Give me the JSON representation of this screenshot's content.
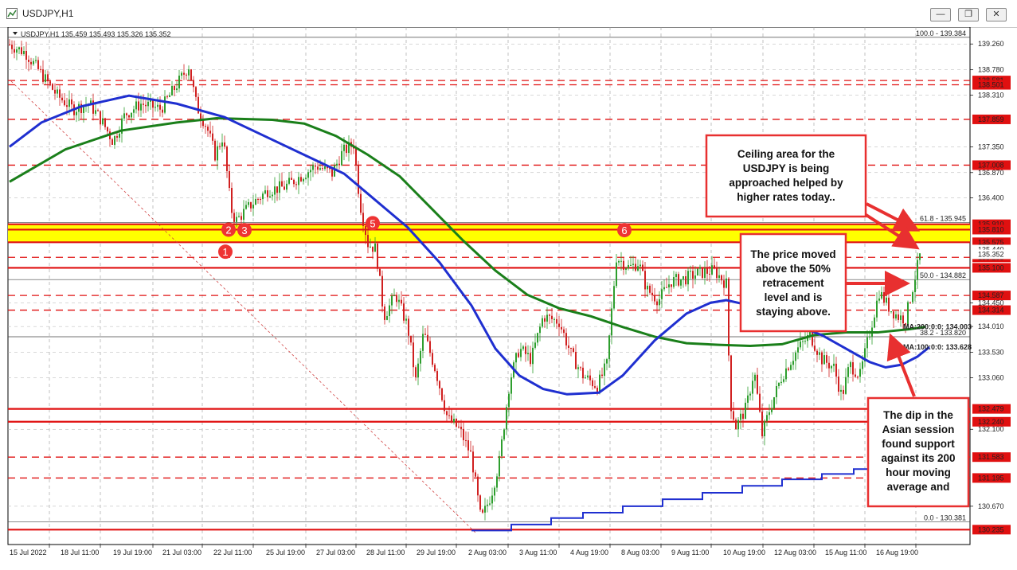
{
  "window": {
    "title": "USDJPY,H1",
    "buttons": [
      "minimize",
      "maximize",
      "close"
    ]
  },
  "chart_data": {
    "type": "candlestick",
    "symbol_label": "USDJPY,H1",
    "ohlc_header": "USDJPY,H1  135.459 135.493 135.326 135.352",
    "y_range": [
      129.9,
      139.55
    ],
    "x_labels": [
      "15 Jul 2022",
      "18 Jul 11:00",
      "19 Jul 19:00",
      "21 Jul 03:00",
      "22 Jul 11:00",
      "25 Jul 19:00",
      "27 Jul 03:00",
      "28 Jul 11:00",
      "29 Jul 19:00",
      "2 Aug 03:00",
      "3 Aug 11:00",
      "4 Aug 19:00",
      "8 Aug 03:00",
      "9 Aug 11:00",
      "10 Aug 19:00",
      "12 Aug 03:00",
      "15 Aug 11:00",
      "16 Aug 19:00"
    ],
    "y_ticks": [
      139.26,
      138.78,
      138.31,
      137.35,
      136.87,
      136.4,
      134.45,
      134.01,
      133.53,
      133.06,
      132.1,
      130.67
    ],
    "highlighted_levels": [
      {
        "value": 138.581,
        "label": "138.581",
        "style": "dashed"
      },
      {
        "value": 138.501,
        "label": "138.501",
        "style": "dashed"
      },
      {
        "value": 137.859,
        "label": "137.859",
        "style": "dashed"
      },
      {
        "value": 137.008,
        "label": "137.008",
        "style": "dashed"
      },
      {
        "value": 135.91,
        "label": "135.910",
        "style": "solid"
      },
      {
        "value": 135.81,
        "label": "135.810",
        "style": "solid"
      },
      {
        "value": 135.575,
        "label": "135.575",
        "style": "solid"
      },
      {
        "value": 135.44,
        "label": "135.440",
        "style": "none"
      },
      {
        "value": 135.295,
        "label": "135.295",
        "style": "dashed"
      },
      {
        "value": 135.1,
        "label": "135.100",
        "style": "solid"
      },
      {
        "value": 134.587,
        "label": "134.587",
        "style": "dashed"
      },
      {
        "value": 134.314,
        "label": "134.314",
        "style": "dashed"
      },
      {
        "value": 132.479,
        "label": "132.479",
        "style": "solid"
      },
      {
        "value": 132.24,
        "label": "132.240",
        "style": "solid"
      },
      {
        "value": 131.583,
        "label": "131.583",
        "style": "dashed"
      },
      {
        "value": 131.195,
        "label": "131.195",
        "style": "dashed"
      },
      {
        "value": 130.235,
        "label": "130.235",
        "style": "solid"
      }
    ],
    "current_price": {
      "value": 135.352,
      "label": "135.352"
    },
    "yellow_zone": [
      135.575,
      135.91
    ],
    "fibonacci": [
      {
        "value": 139.384,
        "label": "100.0 - 139.384"
      },
      {
        "value": 135.945,
        "label": "61.8 - 135.945"
      },
      {
        "value": 134.882,
        "label": "50.0 - 134.882"
      },
      {
        "value": 133.82,
        "label": "38.2 - 133.820"
      },
      {
        "value": 130.381,
        "label": "0.0 - 130.381"
      }
    ],
    "moving_averages": [
      {
        "name": "MA:200:0:0",
        "label": "MA:200:0:0: 134.003",
        "value": 134.003,
        "color": "#1a7f1a",
        "points": [
          [
            0,
            136.7
          ],
          [
            70,
            137.3
          ],
          [
            140,
            137.65
          ],
          [
            210,
            137.8
          ],
          [
            260,
            137.88
          ],
          [
            330,
            137.85
          ],
          [
            370,
            137.78
          ],
          [
            410,
            137.55
          ],
          [
            450,
            137.2
          ],
          [
            490,
            136.8
          ],
          [
            530,
            136.2
          ],
          [
            570,
            135.6
          ],
          [
            610,
            135.05
          ],
          [
            650,
            134.6
          ],
          [
            690,
            134.35
          ],
          [
            730,
            134.2
          ],
          [
            770,
            134.0
          ],
          [
            810,
            133.82
          ],
          [
            850,
            133.7
          ],
          [
            890,
            133.67
          ],
          [
            930,
            133.65
          ],
          [
            970,
            133.68
          ],
          [
            1010,
            133.85
          ],
          [
            1050,
            133.9
          ],
          [
            1090,
            133.9
          ],
          [
            1130,
            133.96
          ],
          [
            1150,
            134.003
          ]
        ]
      },
      {
        "name": "MA:100:0:0",
        "label": "MA:100:0:0: 133.628",
        "value": 133.628,
        "color": "#1f2fd0",
        "points": [
          [
            0,
            137.35
          ],
          [
            40,
            137.8
          ],
          [
            90,
            138.1
          ],
          [
            150,
            138.3
          ],
          [
            210,
            138.15
          ],
          [
            270,
            137.9
          ],
          [
            320,
            137.55
          ],
          [
            370,
            137.2
          ],
          [
            420,
            136.85
          ],
          [
            460,
            136.35
          ],
          [
            500,
            135.85
          ],
          [
            540,
            135.2
          ],
          [
            580,
            134.4
          ],
          [
            610,
            133.6
          ],
          [
            640,
            133.1
          ],
          [
            670,
            132.85
          ],
          [
            700,
            132.75
          ],
          [
            740,
            132.78
          ],
          [
            770,
            133.1
          ],
          [
            810,
            133.75
          ],
          [
            850,
            134.25
          ],
          [
            880,
            134.45
          ],
          [
            900,
            134.5
          ],
          [
            930,
            134.4
          ],
          [
            960,
            134.25
          ],
          [
            990,
            134.02
          ],
          [
            1020,
            133.85
          ],
          [
            1050,
            133.6
          ],
          [
            1080,
            133.35
          ],
          [
            1100,
            133.25
          ],
          [
            1120,
            133.3
          ],
          [
            1140,
            133.45
          ],
          [
            1155,
            133.628
          ]
        ]
      },
      {
        "name": "MA:200-daily",
        "label": "",
        "value": 131.583,
        "color": "#1f2fd0",
        "points": [
          [
            580,
            130.22
          ],
          [
            630,
            130.22
          ],
          [
            630,
            130.33
          ],
          [
            680,
            130.33
          ],
          [
            680,
            130.45
          ],
          [
            720,
            130.45
          ],
          [
            720,
            130.55
          ],
          [
            770,
            130.55
          ],
          [
            770,
            130.67
          ],
          [
            820,
            130.67
          ],
          [
            820,
            130.8
          ],
          [
            870,
            130.8
          ],
          [
            870,
            130.92
          ],
          [
            920,
            130.92
          ],
          [
            920,
            131.05
          ],
          [
            970,
            131.05
          ],
          [
            970,
            131.17
          ],
          [
            1020,
            131.17
          ],
          [
            1020,
            131.27
          ],
          [
            1060,
            131.27
          ],
          [
            1060,
            131.36
          ],
          [
            1090,
            131.36
          ],
          [
            1090,
            131.44
          ],
          [
            1120,
            131.44
          ],
          [
            1120,
            131.5
          ],
          [
            1150,
            131.5
          ]
        ]
      }
    ],
    "price_path": [
      [
        0,
        139.25
      ],
      [
        20,
        139.1
      ],
      [
        40,
        138.7
      ],
      [
        60,
        138.3
      ],
      [
        80,
        138.05
      ],
      [
        100,
        138.15
      ],
      [
        115,
        137.85
      ],
      [
        130,
        137.45
      ],
      [
        145,
        137.95
      ],
      [
        165,
        138.15
      ],
      [
        190,
        138.05
      ],
      [
        210,
        138.5
      ],
      [
        225,
        138.85
      ],
      [
        235,
        138.1
      ],
      [
        248,
        137.7
      ],
      [
        258,
        137.2
      ],
      [
        268,
        137.55
      ],
      [
        278,
        136.2
      ],
      [
        284,
        135.97
      ],
      [
        292,
        136.1
      ],
      [
        305,
        136.3
      ],
      [
        325,
        136.55
      ],
      [
        345,
        136.6
      ],
      [
        365,
        136.8
      ],
      [
        385,
        137.0
      ],
      [
        405,
        136.85
      ],
      [
        418,
        137.25
      ],
      [
        432,
        137.4
      ],
      [
        440,
        136.3
      ],
      [
        450,
        135.55
      ],
      [
        460,
        135.45
      ],
      [
        470,
        134.2
      ],
      [
        485,
        134.6
      ],
      [
        500,
        134.0
      ],
      [
        510,
        133.0
      ],
      [
        520,
        133.9
      ],
      [
        535,
        133.2
      ],
      [
        550,
        132.3
      ],
      [
        565,
        132.1
      ],
      [
        580,
        131.6
      ],
      [
        592,
        130.4
      ],
      [
        605,
        130.9
      ],
      [
        615,
        131.5
      ],
      [
        628,
        133.0
      ],
      [
        640,
        133.6
      ],
      [
        655,
        133.4
      ],
      [
        670,
        134.2
      ],
      [
        690,
        134.1
      ],
      [
        705,
        133.5
      ],
      [
        720,
        133.1
      ],
      [
        738,
        132.9
      ],
      [
        750,
        133.3
      ],
      [
        762,
        135.3
      ],
      [
        778,
        135.1
      ],
      [
        790,
        135.2
      ],
      [
        800,
        134.7
      ],
      [
        815,
        134.5
      ],
      [
        830,
        134.85
      ],
      [
        848,
        134.9
      ],
      [
        865,
        135.0
      ],
      [
        885,
        135.05
      ],
      [
        900,
        134.8
      ],
      [
        905,
        132.6
      ],
      [
        912,
        132.15
      ],
      [
        925,
        132.5
      ],
      [
        935,
        133.2
      ],
      [
        945,
        132.0
      ],
      [
        955,
        132.5
      ],
      [
        970,
        133.1
      ],
      [
        990,
        133.6
      ],
      [
        1005,
        133.85
      ],
      [
        1020,
        133.4
      ],
      [
        1035,
        133.25
      ],
      [
        1045,
        132.7
      ],
      [
        1055,
        133.3
      ],
      [
        1068,
        133.1
      ],
      [
        1080,
        133.9
      ],
      [
        1092,
        134.65
      ],
      [
        1105,
        134.35
      ],
      [
        1115,
        134.2
      ],
      [
        1125,
        134.15
      ],
      [
        1135,
        134.8
      ],
      [
        1145,
        135.45
      ]
    ],
    "markers": [
      {
        "label": "1",
        "x": 283,
        "value": 135.4
      },
      {
        "label": "2",
        "x": 287,
        "value": 135.81
      },
      {
        "label": "3",
        "x": 307,
        "value": 135.8
      },
      {
        "label": "5",
        "x": 468,
        "value": 135.93
      },
      {
        "label": "6",
        "x": 784,
        "value": 135.8
      }
    ],
    "annotations": [
      {
        "id": "ceiling",
        "lines": [
          "Ceiling area for the",
          "USDJPY is being",
          "approached helped by",
          "higher rates today.."
        ]
      },
      {
        "id": "fifty",
        "lines": [
          "The price moved",
          "above the 50%",
          "retracement",
          "level and is",
          "staying above."
        ]
      },
      {
        "id": "dip",
        "lines": [
          "The dip in the",
          "Asian session",
          "found support",
          "against its 200",
          "hour moving",
          "average and"
        ]
      }
    ]
  }
}
